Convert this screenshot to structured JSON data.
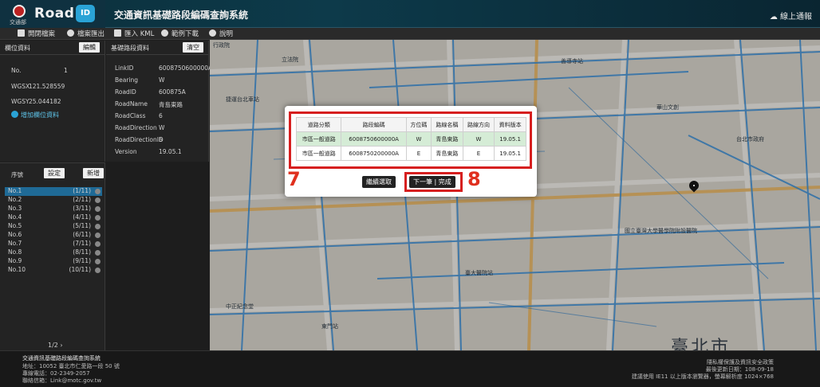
{
  "header": {
    "logo_sub": "交通部",
    "logo_text": "Road",
    "logo_badge": "ID",
    "title": "交通資訊基礎路段編碼查詢系統",
    "report": "線上通報"
  },
  "toolbar": {
    "items": [
      {
        "label": "開閉檔案",
        "icon": "folder-icon"
      },
      {
        "label": "檔案匯出",
        "icon": "export-icon"
      },
      {
        "label": "匯入 KML",
        "icon": "import-kml-icon"
      },
      {
        "label": "範例下載",
        "icon": "download-icon"
      },
      {
        "label": "說明",
        "icon": "help-icon"
      }
    ]
  },
  "position_panel": {
    "title": "欄位資料",
    "edit_label": "編輯",
    "fields": [
      {
        "key": "No.",
        "value": "1"
      },
      {
        "key": "WGSX",
        "value": "121.528559"
      },
      {
        "key": "WGSY",
        "value": "25.044182"
      }
    ],
    "add_label": "增加欄位資料"
  },
  "road_panel": {
    "title": "基礎路段資料",
    "clear_label": "清空",
    "fields": [
      {
        "key": "LinkID",
        "value": "6008750600000A"
      },
      {
        "key": "Bearing",
        "value": "W"
      },
      {
        "key": "RoadID",
        "value": "600875A"
      },
      {
        "key": "RoadName",
        "value": "青島東路"
      },
      {
        "key": "RoadClass",
        "value": "6"
      },
      {
        "key": "RoadDirection",
        "value": "W"
      },
      {
        "key": "RoadDirectionID",
        "value": "6"
      },
      {
        "key": "Version",
        "value": "19.05.1"
      }
    ]
  },
  "list_panel": {
    "title": "序號",
    "settings_label": "設定",
    "add_label": "新增",
    "rows": [
      {
        "name": "No.1",
        "count": "(1/11)"
      },
      {
        "name": "No.2",
        "count": "(2/11)"
      },
      {
        "name": "No.3",
        "count": "(3/11)"
      },
      {
        "name": "No.4",
        "count": "(4/11)"
      },
      {
        "name": "No.5",
        "count": "(5/11)"
      },
      {
        "name": "No.6",
        "count": "(6/11)"
      },
      {
        "name": "No.7",
        "count": "(7/11)"
      },
      {
        "name": "No.8",
        "count": "(8/11)"
      },
      {
        "name": "No.9",
        "count": "(9/11)"
      },
      {
        "name": "No.10",
        "count": "(10/11)"
      }
    ],
    "pager": "1/2 ›"
  },
  "dialog": {
    "columns": [
      "道路分類",
      "路段編碼",
      "方位碼",
      "路線名稱",
      "路線方向",
      "資料版本"
    ],
    "rows": [
      [
        "市區一般道路",
        "6008750600000A",
        "W",
        "青島東路",
        "W",
        "19.05.1"
      ],
      [
        "市區一般道路",
        "6008750200000A",
        "E",
        "青島東路",
        "E",
        "19.05.1"
      ]
    ],
    "annotation_7": "7",
    "annotation_8": "8",
    "continue_label": "繼續選取",
    "next_label": "下一筆 | 完成",
    "highlight_color": "#d61f1f"
  },
  "map": {
    "city": "臺北市",
    "labels": [
      "行政院",
      "立法院",
      "善導寺站",
      "捷運台北車站",
      "國立臺灣大學醫學院附設醫院",
      "臺大醫院站",
      "中正紀念堂",
      "台北市政府",
      "華山文創",
      "東門站"
    ]
  },
  "footer": {
    "left": [
      "交通資訊基礎路段編碼查詢系統",
      "地址：10052 臺北市仁愛路一段 50 號",
      "專線電話：02-2349-2057",
      "聯絡信箱：Link@motc.gov.tw"
    ],
    "right": [
      "隱私權保護及資訊安全政策",
      "最後更新日期：108-09-18",
      "建議使用 IE11 以上版本瀏覽器，螢幕解析度 1024×768"
    ]
  }
}
